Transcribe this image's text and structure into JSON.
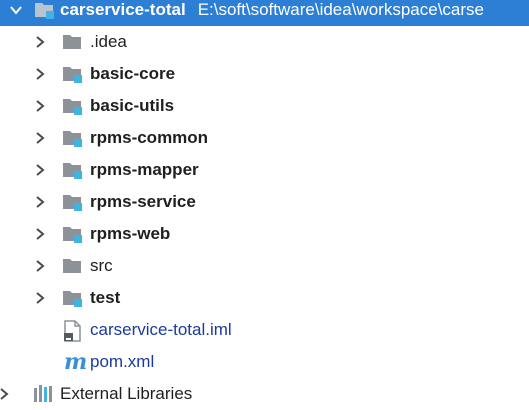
{
  "project": {
    "name": "carservice-total",
    "path": "E:\\soft\\software\\idea\\workspace\\carse"
  },
  "tree": {
    "folders": [
      {
        "label": ".idea",
        "module": false,
        "bold": false
      },
      {
        "label": "basic-core",
        "module": true,
        "bold": true
      },
      {
        "label": "basic-utils",
        "module": true,
        "bold": true
      },
      {
        "label": "rpms-common",
        "module": true,
        "bold": true
      },
      {
        "label": "rpms-mapper",
        "module": true,
        "bold": true
      },
      {
        "label": "rpms-service",
        "module": true,
        "bold": true
      },
      {
        "label": "rpms-web",
        "module": true,
        "bold": true
      },
      {
        "label": "src",
        "module": false,
        "bold": false
      },
      {
        "label": "test",
        "module": true,
        "bold": true
      }
    ],
    "files": [
      {
        "label": "carservice-total.iml",
        "icon": "iml-file-icon"
      },
      {
        "label": "pom.xml",
        "icon": "maven-icon",
        "icon_glyph": "m"
      }
    ],
    "external_libraries": "External Libraries"
  },
  "colors": {
    "selection": "#2d7fd6",
    "folder": "#8c9297",
    "module_marker": "#3fb3e6",
    "file_link": "#1a3a9e"
  }
}
